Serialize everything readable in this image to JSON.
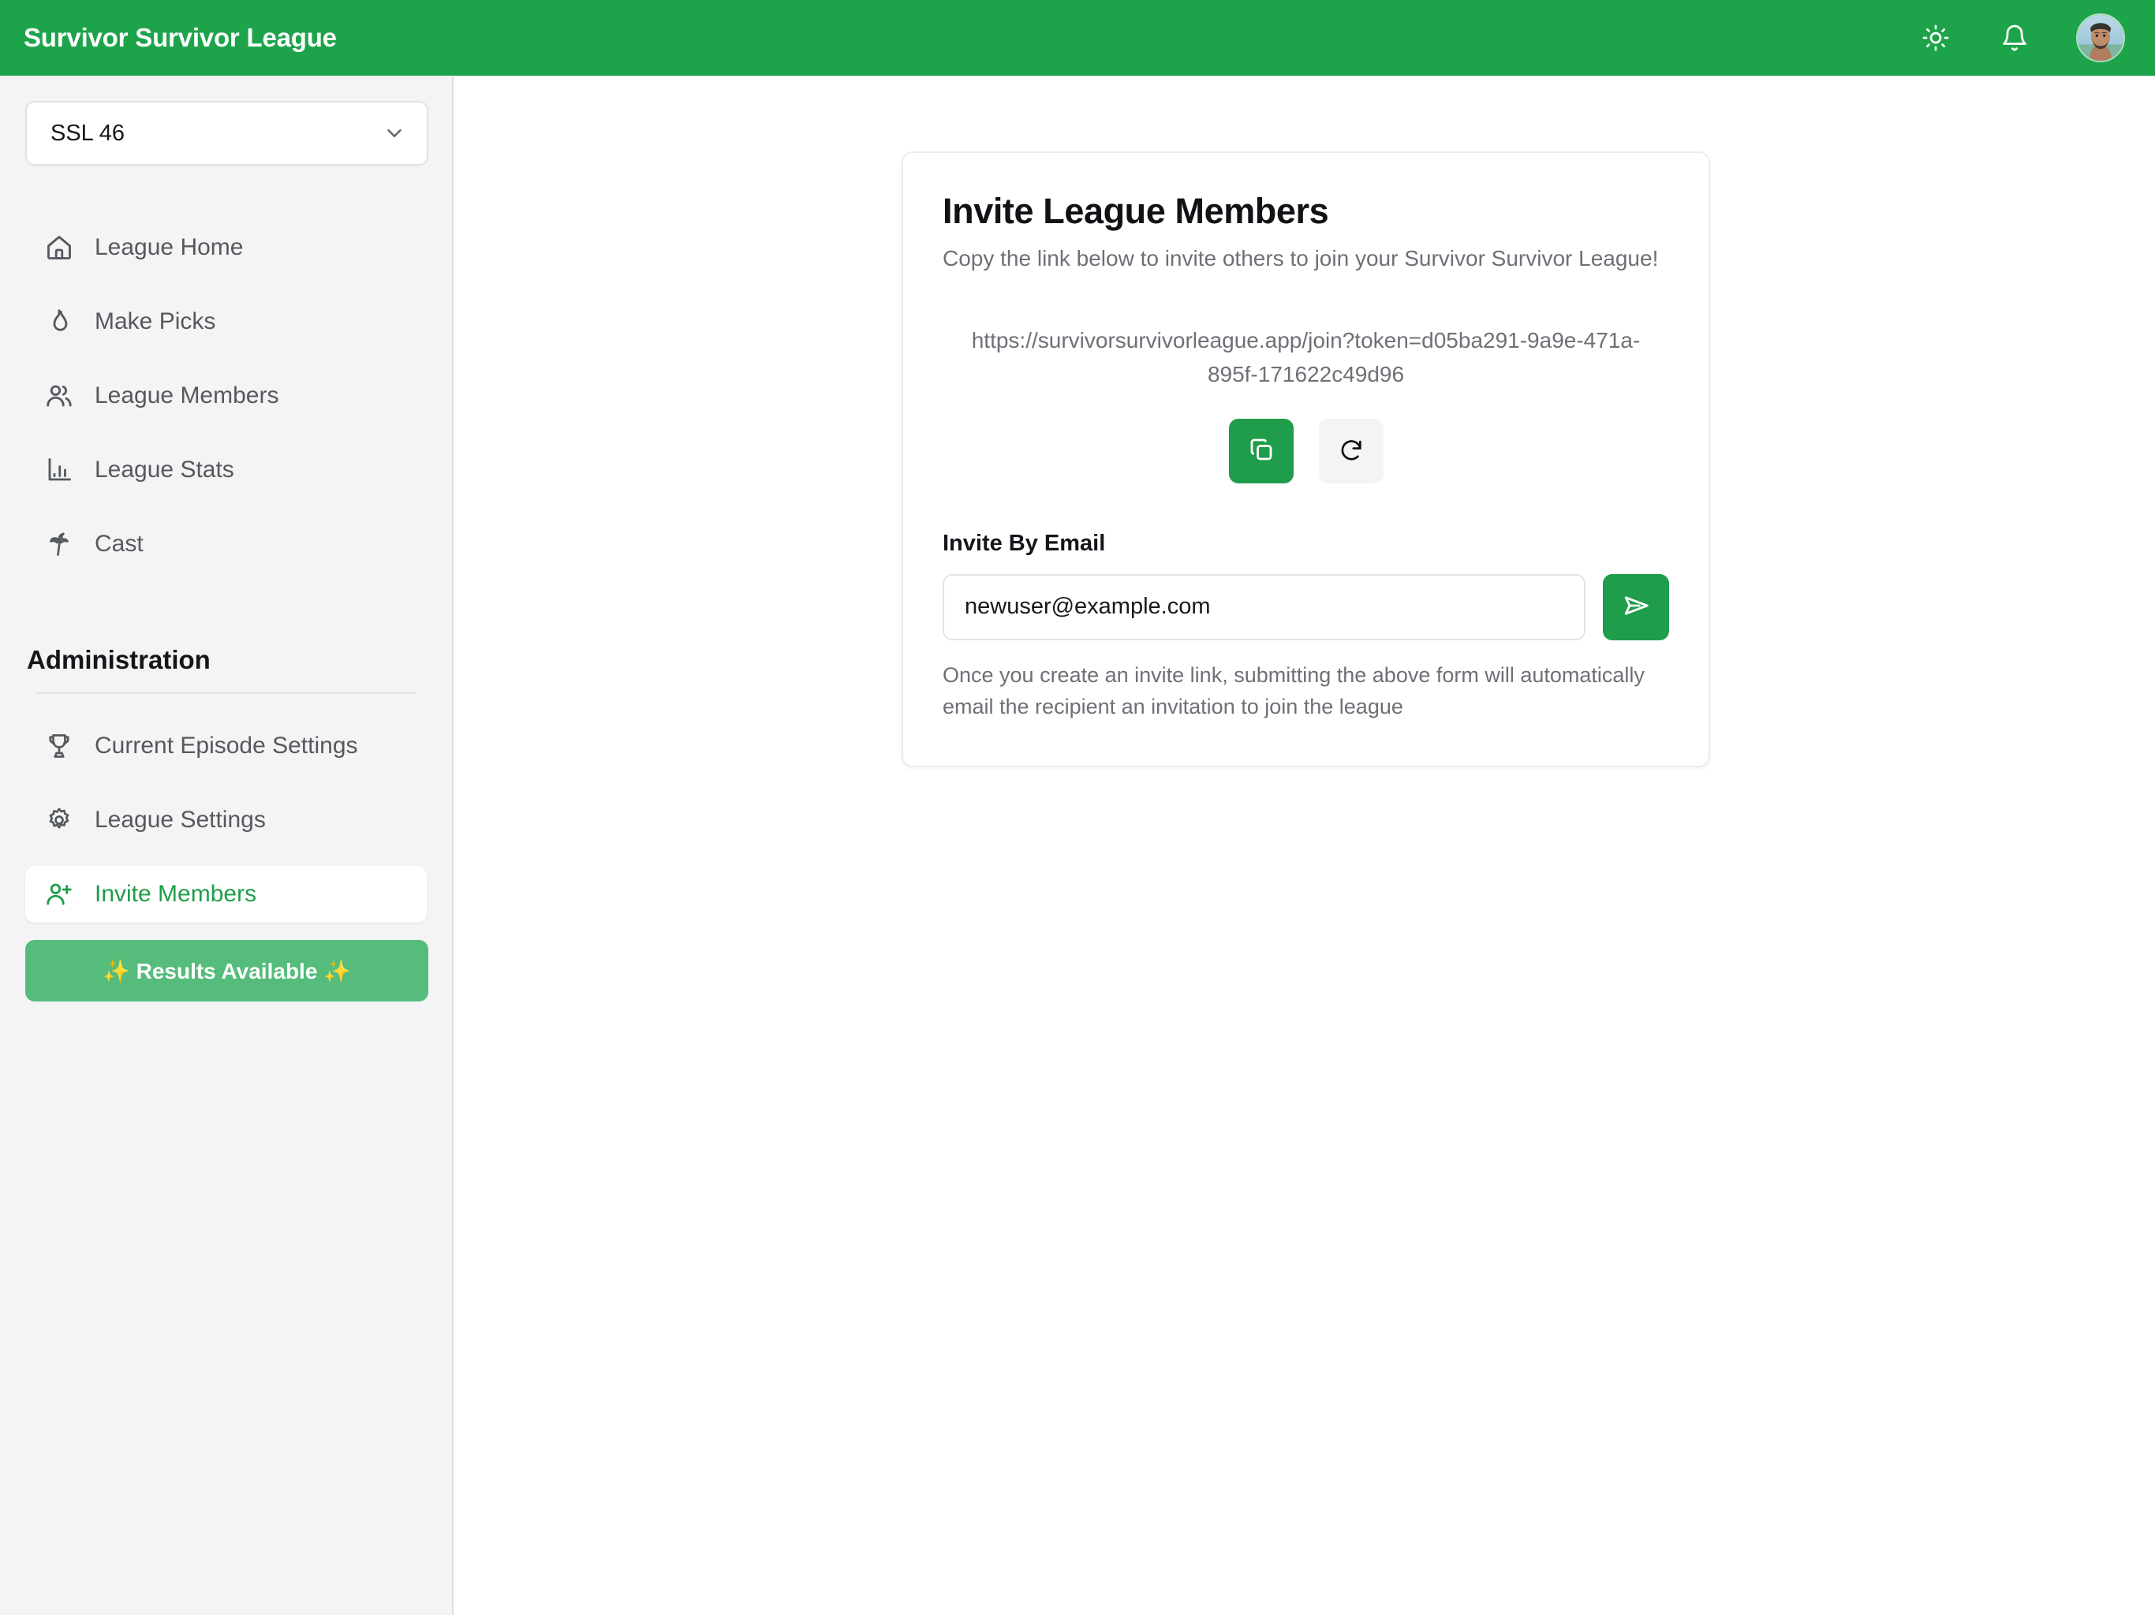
{
  "header": {
    "brand": "Survivor Survivor League",
    "brand_color": "#1da44a",
    "theme_toggle_icon": "sun-icon",
    "notifications_icon": "bell-icon",
    "avatar_icon": "user-avatar"
  },
  "sidebar": {
    "league_selector": {
      "value": "SSL 46",
      "chevron_icon": "chevron-down-icon"
    },
    "nav": [
      {
        "label": "League Home",
        "icon": "house-icon",
        "active": false
      },
      {
        "label": "Make Picks",
        "icon": "flame-icon",
        "active": false
      },
      {
        "label": "League Members",
        "icon": "users-icon",
        "active": false
      },
      {
        "label": "League Stats",
        "icon": "bar-chart-icon",
        "active": false
      },
      {
        "label": "Cast",
        "icon": "palm-tree-icon",
        "active": false
      }
    ],
    "admin_heading": "Administration",
    "admin_nav": [
      {
        "label": "Current Episode Settings",
        "icon": "trophy-icon",
        "active": false
      },
      {
        "label": "League Settings",
        "icon": "gear-icon",
        "active": false
      },
      {
        "label": "Invite Members",
        "icon": "user-plus-icon",
        "active": true
      }
    ],
    "results_button": {
      "label": "✨ Results Available ✨",
      "color": "#55bc7c"
    }
  },
  "main": {
    "card": {
      "title": "Invite League Members",
      "subtitle": "Copy the link below to invite others to join your Survivor Survivor League!",
      "invite_link": "https://survivorsurvivorleague.app/join?token=d05ba291-9a9e-471a-895f-171622c49d96",
      "copy_button_icon": "copy-icon",
      "regenerate_button_icon": "refresh-icon",
      "email_label": "Invite By Email",
      "email_value": "newuser@example.com",
      "email_placeholder": "newuser@example.com",
      "send_button_icon": "send-icon",
      "email_helper": "Once you create an invite link, submitting the above form will automatically email the recipient an invitation to join the league"
    }
  },
  "colors": {
    "accent_green": "#1f9d4a",
    "header_green": "#1da44a",
    "sidebar_bg": "#f4f4f4",
    "muted_text": "#6d7076"
  }
}
